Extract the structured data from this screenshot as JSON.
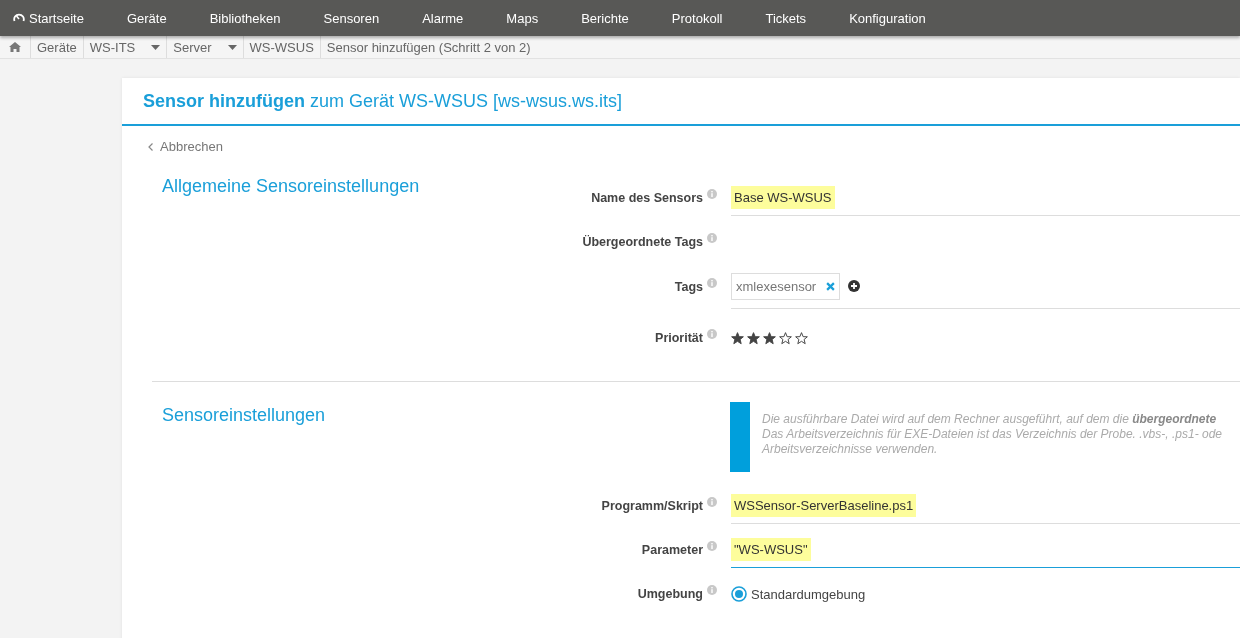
{
  "nav": {
    "home": "Startseite",
    "items": [
      "Geräte",
      "Bibliotheken",
      "Sensoren",
      "Alarme",
      "Maps",
      "Berichte",
      "Protokoll",
      "Tickets",
      "Konfiguration"
    ]
  },
  "breadcrumb": [
    {
      "label": "Geräte",
      "dropdown": false
    },
    {
      "label": "WS-ITS",
      "dropdown": true
    },
    {
      "label": "Server",
      "dropdown": true
    },
    {
      "label": "WS-WSUS",
      "dropdown": false
    },
    {
      "label": "Sensor hinzufügen (Schritt 2 von 2)",
      "dropdown": false
    }
  ],
  "header": {
    "title": "**Sensor hinzufügen** zum Gerät WS-WSUS [ws-wsus.ws.its]"
  },
  "cancel": "Abbrechen",
  "sections": [
    {
      "title": "Allgemeine Sensoreinstellungen",
      "fields": [
        {
          "kind": "text",
          "label": "Name des Sensors",
          "value": "Base WS-WSUS",
          "highlighted": true,
          "focused": false
        },
        {
          "kind": "empty",
          "label": "Übergeordnete Tags"
        },
        {
          "kind": "tags",
          "label": "Tags",
          "tags": [
            "xmlexesensor"
          ]
        },
        {
          "kind": "stars",
          "label": "Priorität",
          "stars": 3
        }
      ]
    },
    {
      "title": "Sensoreinstellungen",
      "fields": [
        {
          "kind": "info",
          "lines": [
            "Die ausführbare Datei wird auf dem Rechner ausgeführt, auf dem die **übergeordnete**",
            "Das Arbeitsverzeichnis für EXE-Dateien ist das Verzeichnis der Probe. .vbs-, .ps1- ode",
            "Arbeitsverzeichnisse verwenden."
          ]
        },
        {
          "kind": "text",
          "label": "Programm/Skript",
          "value": "WSSensor-ServerBaseline.ps1",
          "highlighted": true,
          "focused": false
        },
        {
          "kind": "text",
          "label": "Parameter",
          "value": "\"WS-WSUS\"",
          "highlighted": true,
          "focused": true
        },
        {
          "kind": "radio",
          "label": "Umgebung",
          "options": [
            {
              "label": "Standardumgebung",
              "selected": true
            }
          ]
        }
      ]
    }
  ]
}
